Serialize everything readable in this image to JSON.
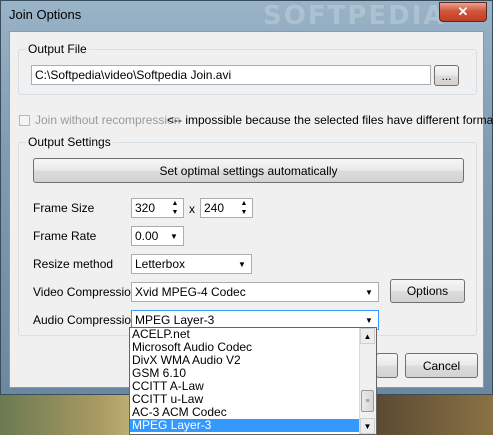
{
  "window": {
    "title": "Join Options",
    "watermark": "SOFTPEDIA",
    "close_label": "✕"
  },
  "output_file": {
    "group_label": "Output File",
    "path_value": "C:\\Softpedia\\video\\Softpedia Join.avi",
    "browse_label": "..."
  },
  "join": {
    "checkbox_label": "Join without recompression",
    "note": "<-- impossible because the selected files have different formats",
    "checked": false
  },
  "output_settings": {
    "group_label": "Output Settings",
    "optimal_button": "Set optimal settings automatically",
    "frame_size_label": "Frame Size",
    "frame_width": "320",
    "frame_x": "x",
    "frame_height": "240",
    "frame_rate_label": "Frame Rate",
    "frame_rate_value": "0.00",
    "resize_label": "Resize method",
    "resize_value": "Letterbox",
    "video_compression_label": "Video Compression",
    "video_compression_value": "Xvid MPEG-4 Codec",
    "options_button": "Options",
    "audio_compression_label": "Audio Compression",
    "audio_compression_value": "MPEG Layer-3"
  },
  "audio_dropdown": {
    "items": [
      "ACELP.net",
      "Microsoft Audio Codec",
      "DivX WMA Audio V2",
      "GSM 6.10",
      "CCITT A-Law",
      "CCITT u-Law",
      "AC-3 ACM Codec",
      "MPEG Layer-3"
    ],
    "selected_index": 7
  },
  "footer": {
    "cancel_label": "Cancel"
  },
  "colors": {
    "selection": "#3399ff",
    "close_button": "#c03d24",
    "disabled_text": "#9a9a9a"
  },
  "icons": {
    "combo_arrow": "chevron-down-icon",
    "spin_up": "spin-up-icon",
    "spin_down": "spin-down-icon"
  }
}
